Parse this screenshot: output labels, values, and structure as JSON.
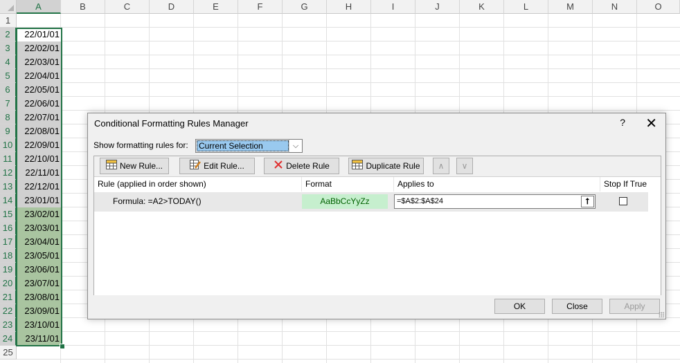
{
  "sheet": {
    "columns": [
      "A",
      "B",
      "C",
      "D",
      "E",
      "F",
      "G",
      "H",
      "I",
      "J",
      "K",
      "L",
      "M",
      "N",
      "O"
    ],
    "rows": [
      "1",
      "2",
      "3",
      "4",
      "5",
      "6",
      "7",
      "8",
      "9",
      "10",
      "11",
      "12",
      "13",
      "14",
      "15",
      "16",
      "17",
      "18",
      "19",
      "20",
      "21",
      "22",
      "23",
      "24",
      "25"
    ],
    "column_a_values": [
      "22/01/01",
      "22/02/01",
      "22/03/01",
      "22/04/01",
      "22/05/01",
      "22/06/01",
      "22/07/01",
      "22/08/01",
      "22/09/01",
      "22/10/01",
      "22/11/01",
      "22/12/01",
      "23/01/01",
      "23/02/01",
      "23/03/01",
      "23/04/01",
      "23/05/01",
      "23/06/01",
      "23/07/01",
      "23/08/01",
      "23/09/01",
      "23/10/01",
      "23/11/01"
    ],
    "highlight_color": "#a9c4a0",
    "selection_color": "#217346"
  },
  "dialog": {
    "title": "Conditional Formatting Rules Manager",
    "help": "?",
    "close": "✕",
    "show_label": "Show formatting rules for:",
    "show_value": "Current Selection",
    "buttons": {
      "new_rule": "New Rule...",
      "edit_rule": "Edit Rule...",
      "delete_rule": "Delete Rule",
      "duplicate_rule": "Duplicate Rule",
      "move_up": "∧",
      "move_down": "∨"
    },
    "headers": {
      "rule": "Rule (applied in order shown)",
      "format": "Format",
      "applies": "Applies to",
      "stop": "Stop If True"
    },
    "rule": {
      "text": "Formula: =A2>TODAY()",
      "format_sample": "AaBbCcYyZz",
      "applies_to": "=$A$2:$A$24"
    },
    "footer": {
      "ok": "OK",
      "close": "Close",
      "apply": "Apply"
    }
  }
}
